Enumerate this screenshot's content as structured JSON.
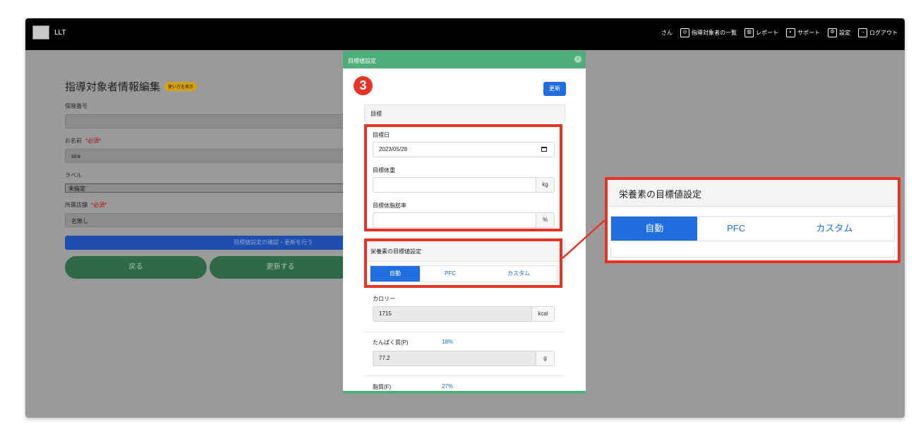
{
  "nav": {
    "brand": "LLT",
    "user_suffix": "さん",
    "items": [
      {
        "label": "指導対象者の一覧",
        "icon": "user-circle-icon"
      },
      {
        "label": "レポート",
        "icon": "chart-icon"
      },
      {
        "label": "サポート",
        "icon": "support-icon"
      },
      {
        "label": "設定",
        "icon": "gear-icon"
      },
      {
        "label": "ログアウト",
        "icon": "logout-icon"
      }
    ]
  },
  "form": {
    "title": "指導対象者情報編集",
    "howto": "使い方を表示",
    "insurance_label": "保険番号",
    "insurance_value": "",
    "name_label": "お名前",
    "required": "*必須*",
    "name_value": "sira",
    "label_label": "ラベル",
    "label_value": "未指定",
    "store_label": "所属店舗",
    "store_value": "名無し",
    "target_button": "目標値設定の確認・更新を行う",
    "back_button": "戻る",
    "update_button": "更新する"
  },
  "modal": {
    "title": "目標値設定",
    "step": "3",
    "update_button": "更新",
    "goal_header": "目標",
    "goal_date_label": "目標日",
    "goal_date_value": "2023/05/28",
    "goal_weight_label": "目標体重",
    "goal_weight_unit": "kg",
    "goal_fat_label": "目標体脂肪率",
    "goal_fat_unit": "%",
    "nutrient_header": "栄養素の目標値設定",
    "modes": [
      "自動",
      "PFC",
      "カスタム"
    ],
    "selected_mode": "自動",
    "calorie_label": "カロリー",
    "calorie_value": "1715",
    "calorie_unit": "kcal",
    "protein_label": "たんぱく質(P)",
    "protein_pct": "18%",
    "protein_value": "77.2",
    "protein_unit": "g",
    "fat_label": "脂質(F)",
    "fat_pct": "27%"
  },
  "zoom": {
    "header": "栄養素の目標値設定",
    "modes": [
      "自動",
      "PFC",
      "カスタム"
    ]
  },
  "colors": {
    "accent_red": "#e53328",
    "modal_green": "#4ead79",
    "primary_blue": "#1f6ddf"
  }
}
